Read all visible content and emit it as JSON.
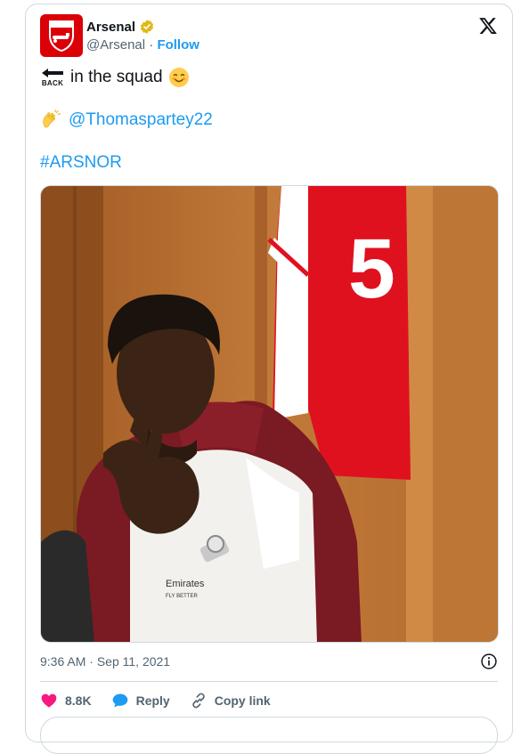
{
  "tweet": {
    "display_name": "Arsenal",
    "handle": "@Arsenal",
    "separator": "·",
    "follow_label": "Follow",
    "back_emoji_label": "BACK",
    "line1_text": "in the squad",
    "mention": "@Thomaspartey22",
    "hashtag": "#ARSNOR",
    "image_shirt_number": "5",
    "shirt_sponsor_line1": "Emirates",
    "shirt_sponsor_line2": "FLY BETTER",
    "time": "9:36 AM",
    "date": "Sep 11, 2021",
    "date_separator": "·"
  },
  "actions": {
    "like_count": "8.8K",
    "reply_label": "Reply",
    "copy_label": "Copy link"
  },
  "colors": {
    "brand_red": "#db0007",
    "link_blue": "#1d9bf0",
    "like_red": "#f91880",
    "muted": "#536471"
  },
  "icons": [
    "verified-badge-icon",
    "x-logo-icon",
    "back-arrow-icon",
    "smiling-face-icon",
    "clapping-hands-icon",
    "info-icon",
    "heart-icon",
    "reply-bubble-icon",
    "link-icon"
  ]
}
